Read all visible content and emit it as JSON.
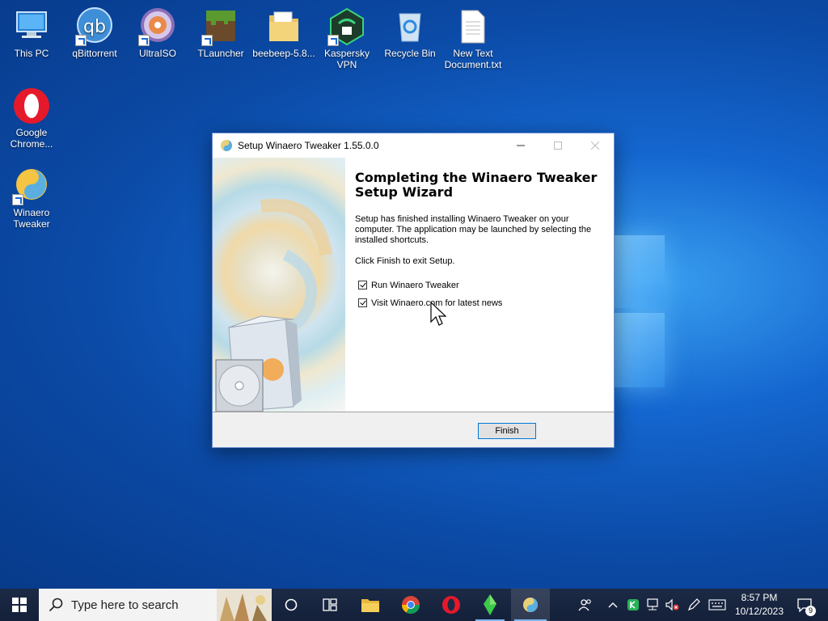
{
  "desktop": {
    "icons": [
      {
        "label": "This PC"
      },
      {
        "label": "qBittorrent",
        "glyph": "qb"
      },
      {
        "label": "UltraISO"
      },
      {
        "label": "TLauncher"
      },
      {
        "label": "beebeep-5.8..."
      },
      {
        "label": "Kaspersky VPN"
      },
      {
        "label": "Recycle Bin"
      },
      {
        "label": "New Text Document.txt"
      },
      {
        "label": "Google Chrome..."
      },
      {
        "label": "Winaero Tweaker"
      }
    ]
  },
  "dialog": {
    "title": "Setup Winaero Tweaker 1.55.0.0",
    "heading": "Completing the Winaero Tweaker Setup Wizard",
    "paragraph1": "Setup has finished installing Winaero Tweaker on your computer. The application may be launched by selecting the installed shortcuts.",
    "paragraph2": "Click Finish to exit Setup.",
    "checkboxes": [
      {
        "label": "Run Winaero Tweaker",
        "checked": true
      },
      {
        "label": "Visit Winaero.com for latest news",
        "checked": true
      }
    ],
    "finish_label": "Finish"
  },
  "taskbar": {
    "search_placeholder": "Type here to search",
    "time": "8:57 PM",
    "date": "10/12/2023",
    "notification_count": "9"
  },
  "colors": {
    "accent": "#0078d7",
    "taskbar": "#14203a"
  }
}
